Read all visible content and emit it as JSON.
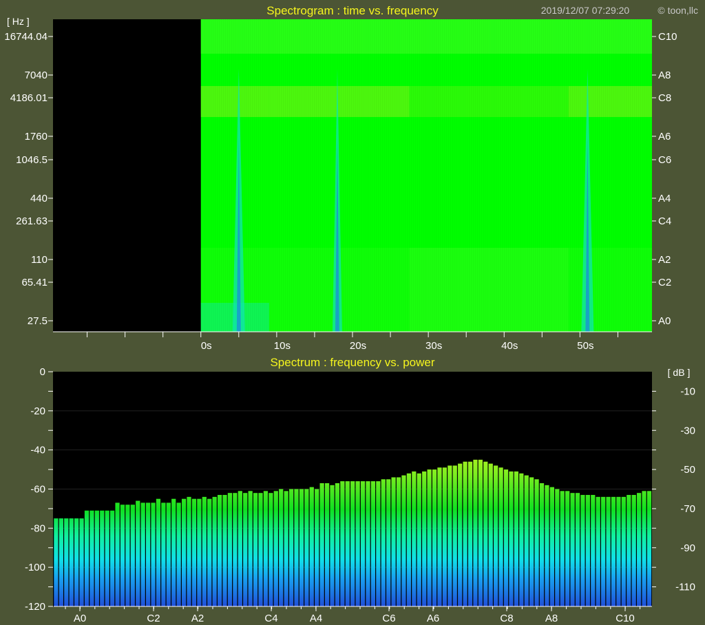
{
  "header": {
    "timestamp": "2019/12/07 07:29:20",
    "copyright": "© toon,llc"
  },
  "colors": {
    "background": "#4c5535",
    "title": "#f5f51e",
    "label": "#ffffff",
    "meta": "#c8c8c8",
    "plot_bg": "#000000",
    "spectrum_top": "#b8f020",
    "spectrum_mid": "#10e020",
    "spectrum_cyan": "#10e0e8",
    "spectrum_bottom": "#2050d8"
  },
  "chart_data": [
    {
      "type": "heatmap",
      "title": "Spectrogram : time vs. frequency",
      "ylabel": "[ Hz ]",
      "y_scale": "log",
      "y_ticks_left": [
        "16744.04",
        "7040",
        "4186.01",
        "1760",
        "1046.5",
        "440",
        "261.63",
        "110",
        "65.41",
        "27.5"
      ],
      "y_ticks_right": [
        "C10",
        "A8",
        "C8",
        "A6",
        "C6",
        "A4",
        "C4",
        "A2",
        "C2",
        "A0"
      ],
      "x_ticks": [
        "0s",
        "10s",
        "20s",
        "30s",
        "40s",
        "50s"
      ],
      "x_values_s": [
        0,
        10,
        20,
        30,
        40,
        50
      ],
      "x_range_s": [
        -19.5,
        59.5
      ],
      "no_data_before_s": 0,
      "bright_bands_s": [
        5,
        18,
        51
      ],
      "segments_s": [
        [
          0,
          9
        ],
        [
          9,
          27.5
        ],
        [
          27.5,
          48.5
        ],
        [
          48.5,
          59.5
        ]
      ],
      "colors": [
        "#00ff00",
        "#4cff2a",
        "#a8f020",
        "#10e8b0",
        "#2088e0"
      ]
    },
    {
      "type": "bar",
      "title": "Spectrum : frequency vs. power",
      "ylabel": "[ dB ]",
      "ylim": [
        -120,
        0
      ],
      "y_ticks_left": [
        0,
        -20,
        -40,
        -60,
        -80,
        -100,
        -120
      ],
      "y_ticks_right": [
        -10,
        -30,
        -50,
        -70,
        -90,
        -110
      ],
      "x_ticks": [
        "A0",
        "C2",
        "A2",
        "C4",
        "A4",
        "C6",
        "A6",
        "C8",
        "A8",
        "C10"
      ],
      "values": [
        -75,
        -75,
        -75,
        -75,
        -75,
        -75,
        -71,
        -71,
        -71,
        -71,
        -71,
        -71,
        -67,
        -68,
        -68,
        -68,
        -66,
        -67,
        -67,
        -67,
        -65,
        -67,
        -67,
        -65,
        -67,
        -65,
        -64,
        -65,
        -65,
        -64,
        -65,
        -64,
        -63,
        -63,
        -62,
        -62,
        -61,
        -62,
        -61,
        -62,
        -62,
        -61,
        -62,
        -61,
        -60,
        -61,
        -60,
        -60,
        -60,
        -60,
        -59,
        -60,
        -57,
        -57,
        -58,
        -57,
        -56,
        -56,
        -56,
        -56,
        -56,
        -56,
        -56,
        -56,
        -55,
        -55,
        -54,
        -54,
        -53,
        -52,
        -51,
        -52,
        -51,
        -50,
        -50,
        -49,
        -49,
        -48,
        -48,
        -47,
        -46,
        -46,
        -45,
        -45,
        -46,
        -47,
        -48,
        -49,
        -50,
        -51,
        -51,
        -52,
        -53,
        -54,
        -55,
        -57,
        -58,
        -59,
        -60,
        -61,
        -61,
        -62,
        -62,
        -63,
        -63,
        -63,
        -64,
        -64,
        -64,
        -64,
        -64,
        -64,
        -63,
        -63,
        -62,
        -61,
        -61
      ]
    }
  ]
}
